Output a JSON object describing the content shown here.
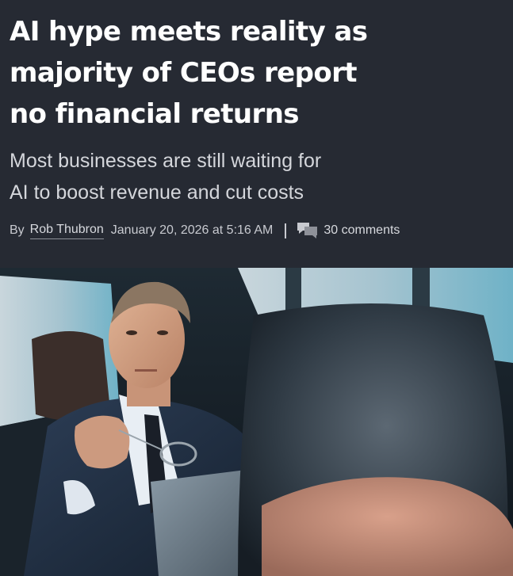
{
  "article": {
    "headline_lines": [
      "AI hype meets reality as",
      "majority of CEOs report",
      "no financial returns"
    ],
    "subhead_lines": [
      "Most businesses are still waiting for",
      "AI to boost revenue and cut costs"
    ],
    "byline": {
      "by_label": "By",
      "author": "Rob Thubron",
      "date": "January 20, 2026 at 5:16 AM",
      "comments": "30 comments",
      "comment_icon": "speech-bubbles-icon"
    }
  },
  "colors": {
    "background": "#262a33",
    "headline": "#ffffff",
    "subhead": "#d4d6db",
    "meta": "#c8cad0"
  }
}
